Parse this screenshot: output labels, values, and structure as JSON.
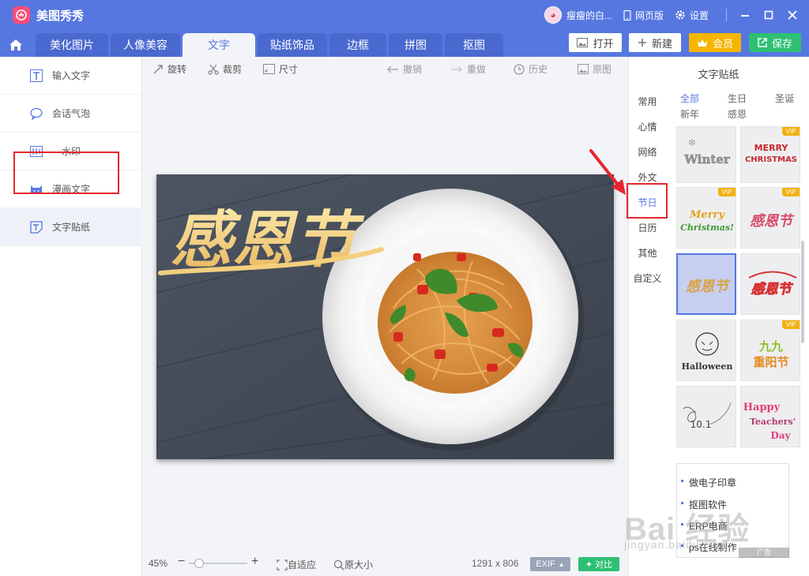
{
  "app": {
    "title": "美图秀秀",
    "user": "瘦瘦的白...",
    "web_version": "网页版",
    "settings": "设置"
  },
  "tabs": [
    "美化图片",
    "人像美容",
    "文字",
    "贴纸饰品",
    "边框",
    "拼图",
    "抠图"
  ],
  "active_tab": "文字",
  "top_buttons": {
    "open": "打开",
    "new": "新建",
    "vip": "会员",
    "save": "保存"
  },
  "left_menu": [
    "输入文字",
    "会话气泡",
    "水印",
    "漫画文字",
    "文字贴纸"
  ],
  "toolbar": {
    "rotate": "旋转",
    "crop": "裁剪",
    "size": "尺寸",
    "undo": "撤销",
    "redo": "重做",
    "history": "历史",
    "original": "原图"
  },
  "canvas": {
    "headline": "感恩节"
  },
  "status": {
    "zoom": "45%",
    "fit": "自适应",
    "actual": "原大小",
    "dimensions": "1291 x 806",
    "exif": "EXIF",
    "compare": "对比"
  },
  "right_panel": {
    "title": "文字贴纸",
    "categories": [
      "常用",
      "心情",
      "网络",
      "外文",
      "节日",
      "日历",
      "其他",
      "自定义"
    ],
    "active_category": "节日",
    "subcategories": [
      "全部",
      "生日",
      "圣诞",
      "新年",
      "感恩"
    ],
    "active_subcategory": "全部",
    "stickers": [
      {
        "text": "Winter",
        "vip": false
      },
      {
        "text": "MERRY CHRISTMAS",
        "vip": true
      },
      {
        "text": "Merry Christmas!",
        "vip": true
      },
      {
        "text": "感恩节",
        "vip": true
      },
      {
        "text": "感恩节",
        "vip": false
      },
      {
        "text": "感恩节",
        "vip": false
      },
      {
        "text": "Halloween",
        "vip": false
      },
      {
        "text": "九九重阳节",
        "vip": true
      },
      {
        "text": "10.1",
        "vip": false
      },
      {
        "text": "Happy Teachers' Day",
        "vip": false
      }
    ],
    "vip_label": "VIP"
  },
  "ad": {
    "items": [
      "做电子印章",
      "抠图软件",
      "ERP电商",
      "ps在线制作"
    ],
    "tag": "广告"
  },
  "watermark": {
    "logo": "Bai 经验",
    "url": "jingyan.baidu.com"
  }
}
